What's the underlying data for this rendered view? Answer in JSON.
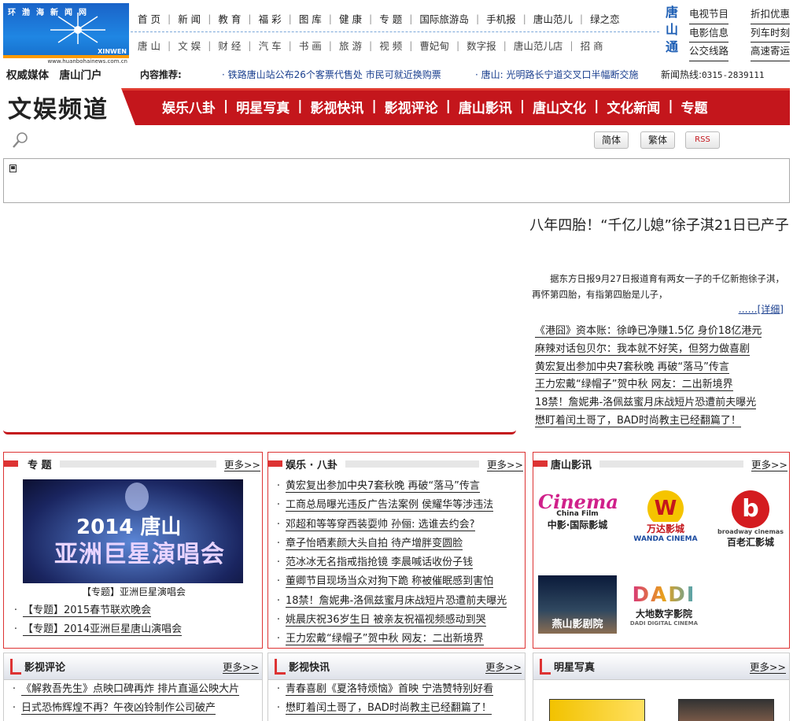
{
  "logo": {
    "name": "环渤海新闻网",
    "xinwen": "XINWEN",
    "url": "www.huanbohainews.com.cn"
  },
  "nav_top": [
    "首 页",
    "新 闻",
    "教 育",
    "福 彩",
    "图 库",
    "健 康",
    "专 题",
    "国际旅游岛",
    "手机报",
    "唐山范儿",
    "绿之恋"
  ],
  "nav_bottom": [
    "唐 山",
    "文 娱",
    "财 经",
    "汽 车",
    "书 画",
    "旅 游",
    "视 频",
    "曹妃甸",
    "数字报",
    "唐山范儿店",
    "招 商"
  ],
  "tangshan_tong": [
    "唐",
    "山",
    "通"
  ],
  "quick_links": [
    [
      "电视节目",
      "折扣优惠"
    ],
    [
      "电影信息",
      "列车时刻"
    ],
    [
      "公交线路",
      "高速寄运"
    ]
  ],
  "sub_slogan": "权威媒体　唐山门户",
  "recommend": {
    "label": "内容推荐:",
    "item1": "· 铁路唐山站公布26个客票代售处 市民可就近换购票",
    "item2": "· 唐山: 光明路长宁道交叉口半幅断交施"
  },
  "hotline": {
    "label": "新闻热线:",
    "number": "0315-2839111"
  },
  "channel": "文娱频道",
  "main_nav": [
    "娱乐八卦",
    "明星写真",
    "影视快讯",
    "影视评论",
    "唐山影讯",
    "唐山文化",
    "文化新闻",
    "专题"
  ],
  "buttons": {
    "simplified": "简体",
    "traditional": "繁体",
    "rss": "RSS"
  },
  "headline": {
    "title": "八年四胎！“千亿儿媳”徐子淇21日已产子",
    "summary": "据东方日报9月27日报道育有两女一子的千亿新抱徐子淇，再怀第四胎，有指第四胎是儿子，",
    "detail": "……[详细]"
  },
  "headline_list": [
    "《港囧》资本账：徐峥已净赚1.5亿 身价18亿港元",
    "麻辣对话包贝尔：我本就不好笑，但努力做喜剧",
    "黄宏复出参加中央7套秋晚 再破“落马”传言",
    "王力宏戴“绿帽子”贺中秋 网友：二出新境界",
    "18禁！詹妮弗-洛佩兹蜜月床战短片恐遭前夫曝光",
    "懋盯着闰土哥了，BAD时尚教主已经翻篇了！"
  ],
  "more": "更多>>",
  "zhuanti": {
    "title": "专 题",
    "promo_city": "2014 唐山",
    "promo_title": "亚洲巨星演唱会",
    "caption": "【专题】亚洲巨星演唱会",
    "items": [
      "【专题】2015春节联欢晚会",
      "【专题】2014亚洲巨星唐山演唱会"
    ]
  },
  "bagua": {
    "title": "娱乐 · 八卦",
    "items": [
      "黄宏复出参加中央7套秋晚 再破“落马”传言",
      "工商总局曝光违反广告法案例 侯耀华等涉违法",
      "邓超和等等穿西装耍帅 孙俪: 选谁去约会?",
      "章子怡晒素颜大头自拍 待产增胖变圆脸",
      "范冰冰无名指戒指抢镜 李晨喊话收份子钱",
      "董卿节目现场当众对狗下跪 称被催眠感到害怕",
      "18禁！詹妮弗-洛佩兹蜜月床战短片恐遭前夫曝光",
      "姚晨庆祝36岁生日 被亲友祝福视频感动到哭",
      "王力宏戴“绿帽子”贺中秋 网友：二出新境界"
    ]
  },
  "tangshan_yingxun": {
    "title": "唐山影讯",
    "cinemas": [
      "中影·国际影城",
      "万达影城",
      "百老汇影城",
      "燕山影剧院",
      "大地数字影院"
    ],
    "logo_text": [
      "Cinema",
      "China Film",
      "WANDA CINEMA",
      "broadway cinemas",
      "DADI",
      "DADI DIGITAL CINEMA"
    ]
  },
  "pinglun": {
    "title": "影视评论",
    "items": [
      "《解救吾先生》点映口碑再炸 排片直逼公映大片",
      "日式恐怖辉煌不再？午夜凶铃制作公司破产"
    ]
  },
  "kuaixun": {
    "title": "影视快讯",
    "items": [
      "青春喜剧《夏洛特烦恼》首映 宁浩赞特别好看",
      "懋盯着闰土哥了，BAD时尚教主已经翻篇了！"
    ]
  },
  "xiezhen": {
    "title": "明星写真"
  },
  "colors": {
    "brand_red": "#c4161c",
    "link_blue": "#1a3f8f"
  }
}
